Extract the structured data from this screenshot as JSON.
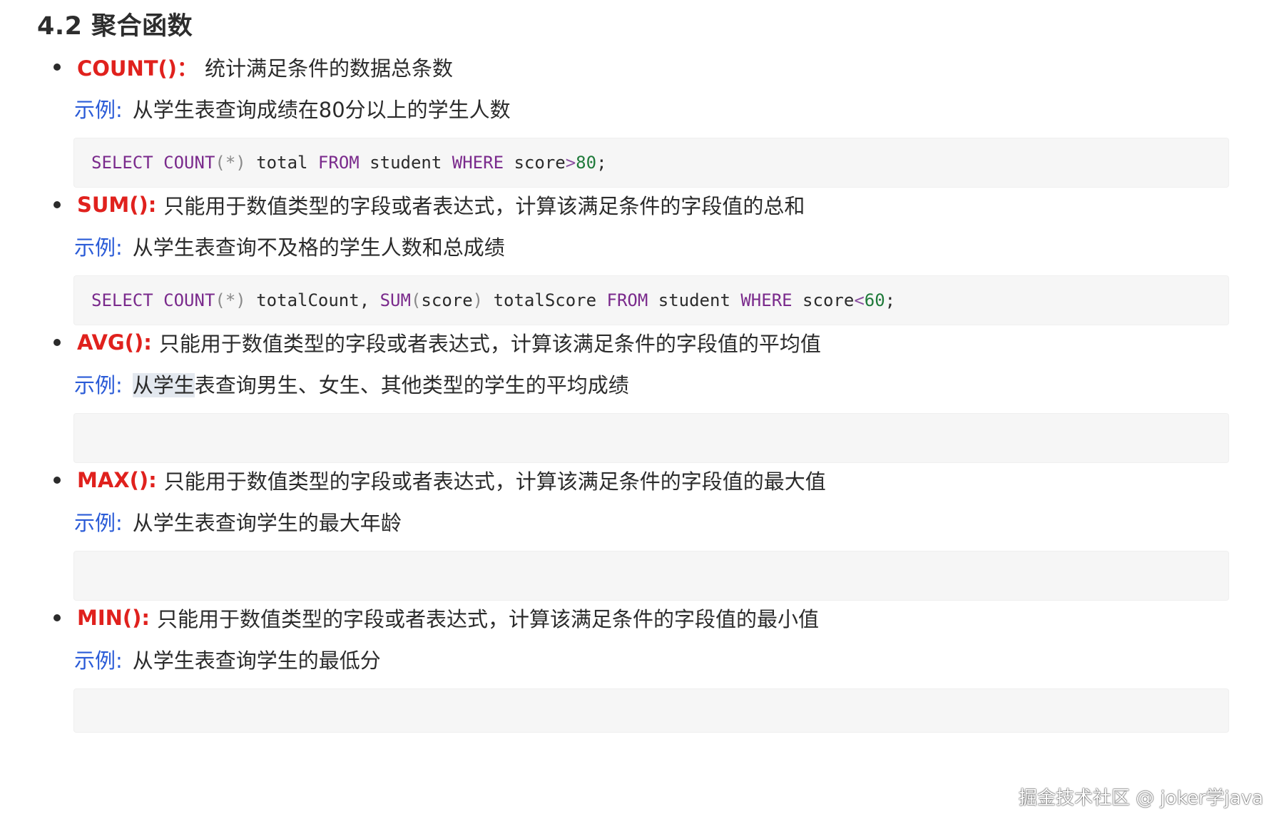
{
  "heading": "4.2 聚合函数",
  "sections": [
    {
      "fn": "COUNT()：",
      "desc": "统计满足条件的数据总条数",
      "example_label": "示例:",
      "example_text": "从学生表查询成绩在80分以上的学生人数",
      "code": [
        {
          "t": "kw",
          "v": "SELECT"
        },
        {
          "t": "id",
          "v": " "
        },
        {
          "t": "kw",
          "v": "COUNT"
        },
        {
          "t": "punc",
          "v": "(*)"
        },
        {
          "t": "id",
          "v": " total "
        },
        {
          "t": "kw",
          "v": "FROM"
        },
        {
          "t": "id",
          "v": " student "
        },
        {
          "t": "kw",
          "v": "WHERE"
        },
        {
          "t": "id",
          "v": " score"
        },
        {
          "t": "op",
          "v": ">"
        },
        {
          "t": "num",
          "v": "80"
        },
        {
          "t": "id",
          "v": ";"
        }
      ]
    },
    {
      "fn": "SUM():",
      "desc": "只能用于数值类型的字段或者表达式，计算该满足条件的字段值的总和",
      "example_label": "示例:",
      "example_text": "从学生表查询不及格的学生人数和总成绩",
      "code": [
        {
          "t": "kw",
          "v": "SELECT"
        },
        {
          "t": "id",
          "v": " "
        },
        {
          "t": "kw",
          "v": "COUNT"
        },
        {
          "t": "punc",
          "v": "(*)"
        },
        {
          "t": "id",
          "v": " totalCount, "
        },
        {
          "t": "kw",
          "v": "SUM"
        },
        {
          "t": "punc",
          "v": "("
        },
        {
          "t": "id",
          "v": "score"
        },
        {
          "t": "punc",
          "v": ")"
        },
        {
          "t": "id",
          "v": " totalScore "
        },
        {
          "t": "kw",
          "v": "FROM"
        },
        {
          "t": "id",
          "v": " student "
        },
        {
          "t": "kw",
          "v": "WHERE"
        },
        {
          "t": "id",
          "v": " score"
        },
        {
          "t": "op",
          "v": "<"
        },
        {
          "t": "num",
          "v": "60"
        },
        {
          "t": "id",
          "v": ";"
        }
      ]
    },
    {
      "fn": "AVG():",
      "desc": "只能用于数值类型的字段或者表达式，计算该满足条件的字段值的平均值",
      "example_label": "示例:",
      "example_text_hl": "从学生",
      "example_text": "表查询男生、女生、其他类型的学生的平均成绩",
      "code": []
    },
    {
      "fn": "MAX():",
      "desc": "只能用于数值类型的字段或者表达式，计算该满足条件的字段值的最大值",
      "example_label": "示例:",
      "example_text": "从学生表查询学生的最大年龄",
      "code": []
    },
    {
      "fn": "MIN():",
      "desc": "只能用于数值类型的字段或者表达式，计算该满足条件的字段值的最小值",
      "example_label": "示例:",
      "example_text": "从学生表查询学生的最低分",
      "code": []
    }
  ],
  "watermark": "掘金技术社区 @ joker学java",
  "colors": {
    "function_name": "#e0211d",
    "example_label": "#2a5bd7",
    "keyword": "#7a2a8c",
    "number": "#1f7a3a",
    "code_bg": "#f6f6f6"
  }
}
